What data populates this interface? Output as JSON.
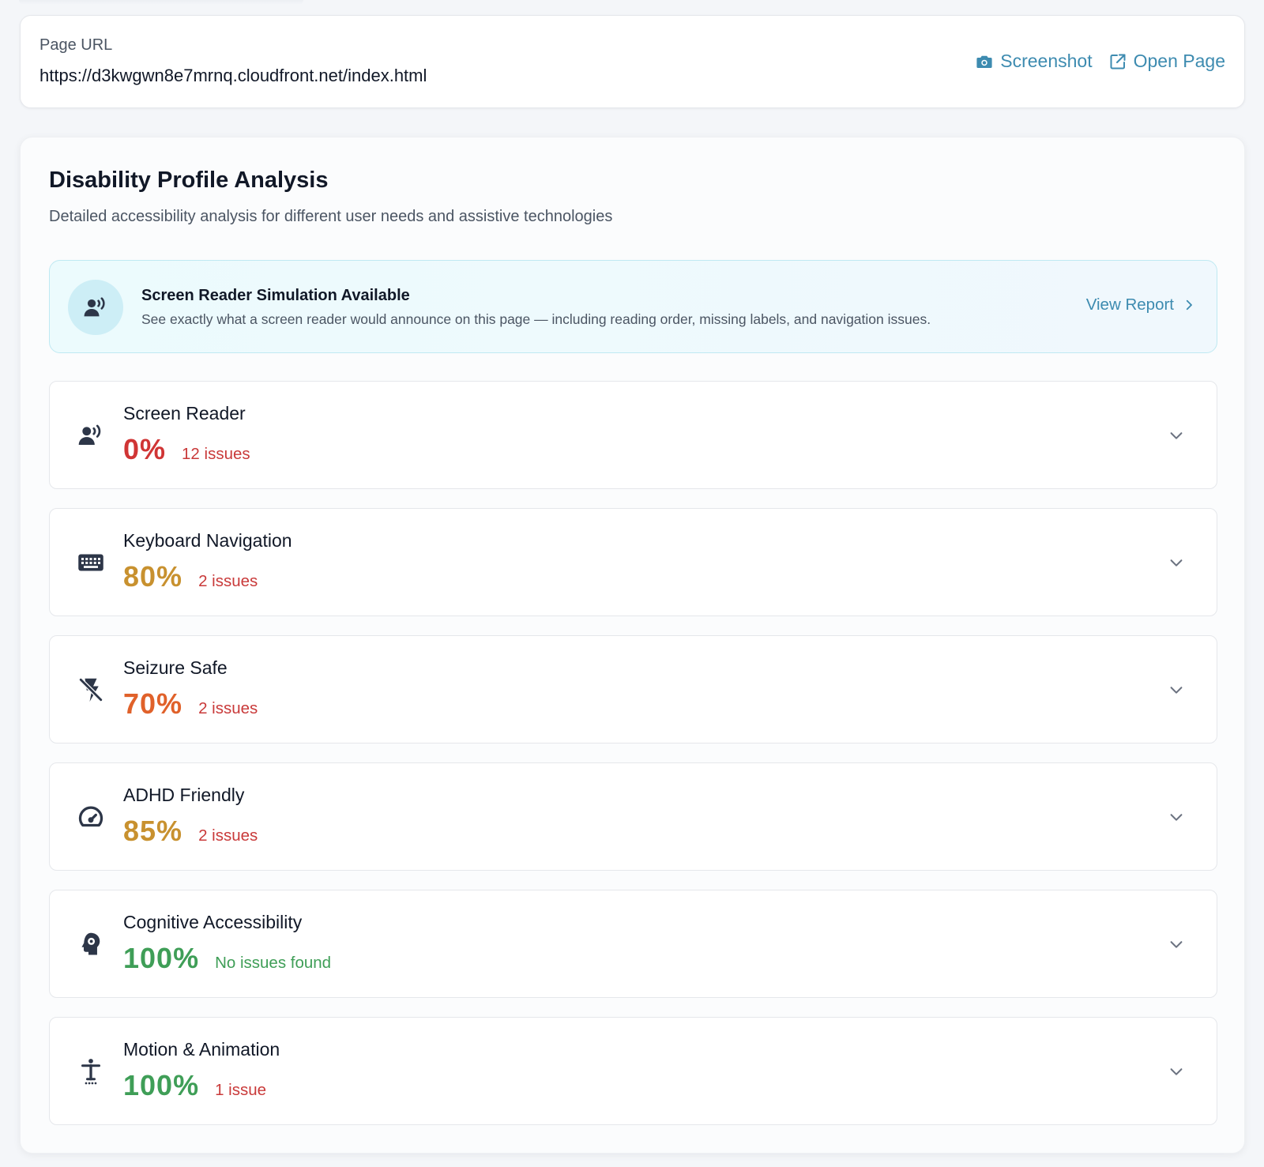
{
  "url_card": {
    "label": "Page URL",
    "value": "https://d3kwgwn8e7mrnq.cloudfront.net/index.html",
    "actions": [
      {
        "label": "Screenshot",
        "icon": "camera-icon"
      },
      {
        "label": "Open Page",
        "icon": "external-link-icon"
      }
    ]
  },
  "panel": {
    "title": "Disability Profile Analysis",
    "subtitle": "Detailed accessibility analysis for different user needs and assistive technologies"
  },
  "simulation_banner": {
    "icon": "speaking-person-icon",
    "title": "Screen Reader Simulation Available",
    "description": "See exactly what a screen reader would announce on this page — including reading order, missing labels, and navigation issues.",
    "action_label": "View Report"
  },
  "profiles": [
    {
      "name": "Screen Reader",
      "score": "0%",
      "issues": "12 issues",
      "icon": "speaking-person-icon",
      "score_color": "#d03535",
      "issues_color": "#c93a3a"
    },
    {
      "name": "Keyboard Navigation",
      "score": "80%",
      "issues": "2 issues",
      "icon": "keyboard-icon",
      "score_color": "#c8912f",
      "issues_color": "#c93a3a"
    },
    {
      "name": "Seizure Safe",
      "score": "70%",
      "issues": "2 issues",
      "icon": "flash-off-icon",
      "score_color": "#e0612a",
      "issues_color": "#c93a3a"
    },
    {
      "name": "ADHD Friendly",
      "score": "85%",
      "issues": "2 issues",
      "icon": "gauge-icon",
      "score_color": "#c8912f",
      "issues_color": "#c93a3a"
    },
    {
      "name": "Cognitive Accessibility",
      "score": "100%",
      "issues": "No issues found",
      "icon": "brain-head-icon",
      "score_color": "#3f9e57",
      "issues_color": "#3f9e57"
    },
    {
      "name": "Motion & Animation",
      "score": "100%",
      "issues": "1 issue",
      "icon": "accessibility-person-icon",
      "score_color": "#3f9e57",
      "issues_color": "#c93a3a"
    }
  ],
  "colors": {
    "accent": "#3d8bb0",
    "icon_dark": "#2d3648",
    "chevron": "#6b7280"
  }
}
